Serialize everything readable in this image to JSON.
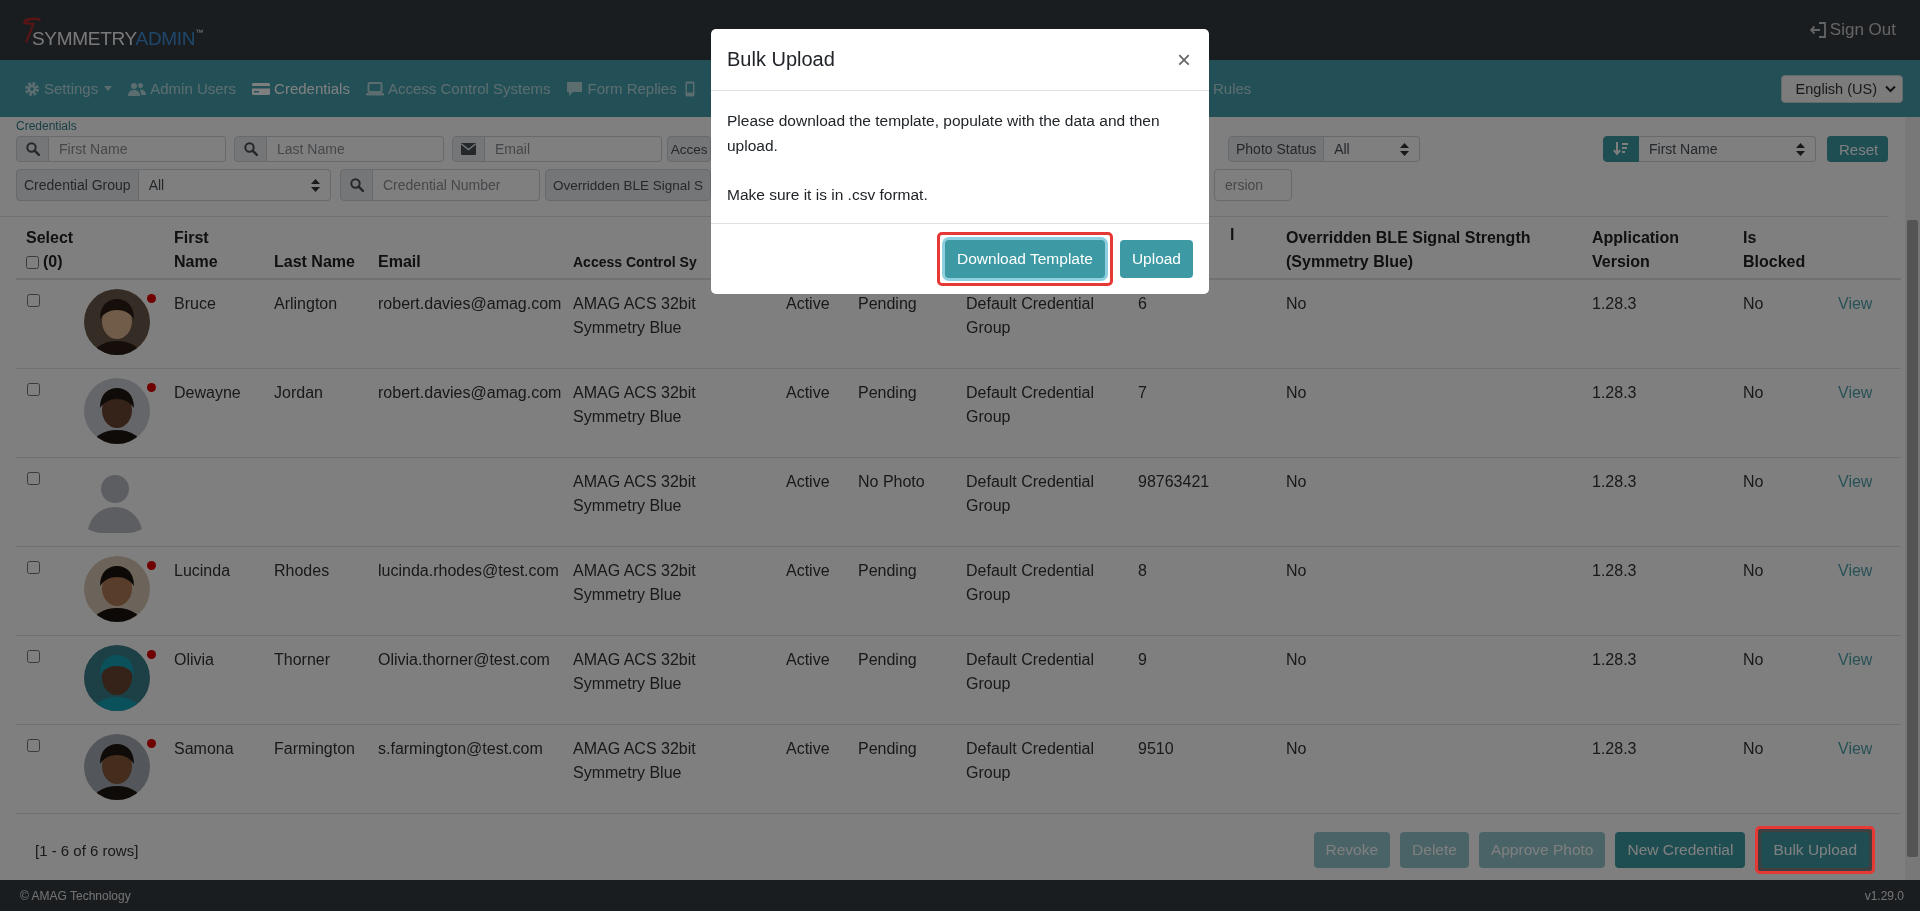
{
  "header": {
    "logo": {
      "name": "SYMMETRY",
      "accent": "ADMIN",
      "trademark": "™"
    },
    "sign_out": "Sign Out"
  },
  "nav": {
    "items": [
      {
        "label": "Settings",
        "selected": false,
        "dropdown": true
      },
      {
        "label": "Admin Users",
        "selected": false,
        "dropdown": false
      },
      {
        "label": "Credentials",
        "selected": true,
        "dropdown": false
      },
      {
        "label": "Access Control Systems",
        "selected": false,
        "dropdown": false
      },
      {
        "label": "Form Replies",
        "selected": false,
        "dropdown": false
      },
      {
        "label": "Rules",
        "selected": false,
        "dropdown": false
      }
    ],
    "language": "English (US)"
  },
  "breadcrumb": "Credentials",
  "filters": [
    [
      {
        "kind": "search",
        "placeholder": "First Name"
      },
      {
        "kind": "search",
        "placeholder": "Last Name"
      },
      {
        "kind": "email",
        "placeholder": "Email"
      },
      {
        "kind": "label",
        "label": "Acces"
      },
      {
        "kind": "select",
        "label": "Photo Status",
        "value": "All"
      },
      {
        "kind": "sort",
        "value": "First Name"
      },
      {
        "kind": "button",
        "label": "Reset"
      }
    ],
    [
      {
        "kind": "select",
        "label": "Credential Group",
        "value": "All"
      },
      {
        "kind": "search",
        "placeholder": "Credential Number"
      },
      {
        "kind": "label",
        "label": "Overridden BLE Signal S"
      },
      {
        "kind": "text",
        "placeholder": "ersion"
      }
    ]
  ],
  "table": {
    "columns": [
      {
        "label": "Select",
        "count": "(0)",
        "checked": false
      },
      null,
      "First Name",
      "Last Name",
      "Email",
      "Access Control Sy",
      null,
      null,
      null,
      "l",
      "Overridden BLE Signal Strength (Symmetry Blue)",
      "Application Version",
      "Is Blocked",
      null
    ],
    "rows": [
      {
        "selected": false,
        "photo": true,
        "flagged": true,
        "first": "Bruce",
        "last": "Arlington",
        "email": "robert.davies@amag.com",
        "acs": "AMAG ACS 32bit Symmetry Blue",
        "status": "Active",
        "photo_status": "Pending",
        "group": "Default Credential Group",
        "number": "6",
        "ble": "No",
        "version": "1.28.3",
        "blocked": "No",
        "action": "View"
      },
      {
        "selected": false,
        "photo": true,
        "flagged": true,
        "first": "Dewayne",
        "last": "Jordan",
        "email": "robert.davies@amag.com",
        "acs": "AMAG ACS 32bit Symmetry Blue",
        "status": "Active",
        "photo_status": "Pending",
        "group": "Default Credential Group",
        "number": "7",
        "ble": "No",
        "version": "1.28.3",
        "blocked": "No",
        "action": "View"
      },
      {
        "selected": false,
        "photo": false,
        "flagged": false,
        "acs": "AMAG ACS 32bit Symmetry Blue",
        "status": "Active",
        "photo_status": "No Photo",
        "group": "Default Credential Group",
        "number": "98763421",
        "ble": "No",
        "version": "1.28.3",
        "blocked": "No",
        "action": "View"
      },
      {
        "selected": false,
        "photo": true,
        "flagged": true,
        "first": "Lucinda",
        "last": "Rhodes",
        "email": "lucinda.rhodes@test.com",
        "acs": "AMAG ACS 32bit Symmetry Blue",
        "status": "Active",
        "photo_status": "Pending",
        "group": "Default Credential Group",
        "number": "8",
        "ble": "No",
        "version": "1.28.3",
        "blocked": "No",
        "action": "View"
      },
      {
        "selected": false,
        "photo": true,
        "flagged": true,
        "first": "Olivia",
        "last": "Thorner",
        "email": "Olivia.thorner@test.com",
        "acs": "AMAG ACS 32bit Symmetry Blue",
        "status": "Active",
        "photo_status": "Pending",
        "group": "Default Credential Group",
        "number": "9",
        "ble": "No",
        "version": "1.28.3",
        "blocked": "No",
        "action": "View"
      },
      {
        "selected": false,
        "photo": true,
        "flagged": true,
        "first": "Samona",
        "last": "Farmington",
        "email": "s.farmington@test.com",
        "acs": "AMAG ACS 32bit Symmetry Blue",
        "status": "Active",
        "photo_status": "Pending",
        "group": "Default Credential Group",
        "number": "9510",
        "ble": "No",
        "version": "1.28.3",
        "blocked": "No",
        "action": "View"
      }
    ]
  },
  "pager": {
    "summary": "[1 - 6 of 6 rows]",
    "buttons": [
      {
        "label": "Revoke",
        "disabled": true,
        "highlighted": false
      },
      {
        "label": "Delete",
        "disabled": true,
        "highlighted": false
      },
      {
        "label": "Approve Photo",
        "disabled": true,
        "highlighted": false
      },
      {
        "label": "New Credential",
        "disabled": false,
        "highlighted": false
      },
      {
        "label": "Bulk Upload",
        "disabled": false,
        "highlighted": true
      }
    ]
  },
  "footer": {
    "copyright": "© AMAG Technology",
    "version": "v1.29.0"
  },
  "modal": {
    "title": "Bulk Upload",
    "close": "×",
    "paragraphs": [
      "Please download the template, populate with the data and then upload.",
      "Make sure it is in .csv format."
    ],
    "buttons": [
      {
        "label": "Download Template",
        "highlighted": true,
        "focused": true
      },
      {
        "label": "Upload",
        "highlighted": false,
        "focused": false
      }
    ]
  }
}
